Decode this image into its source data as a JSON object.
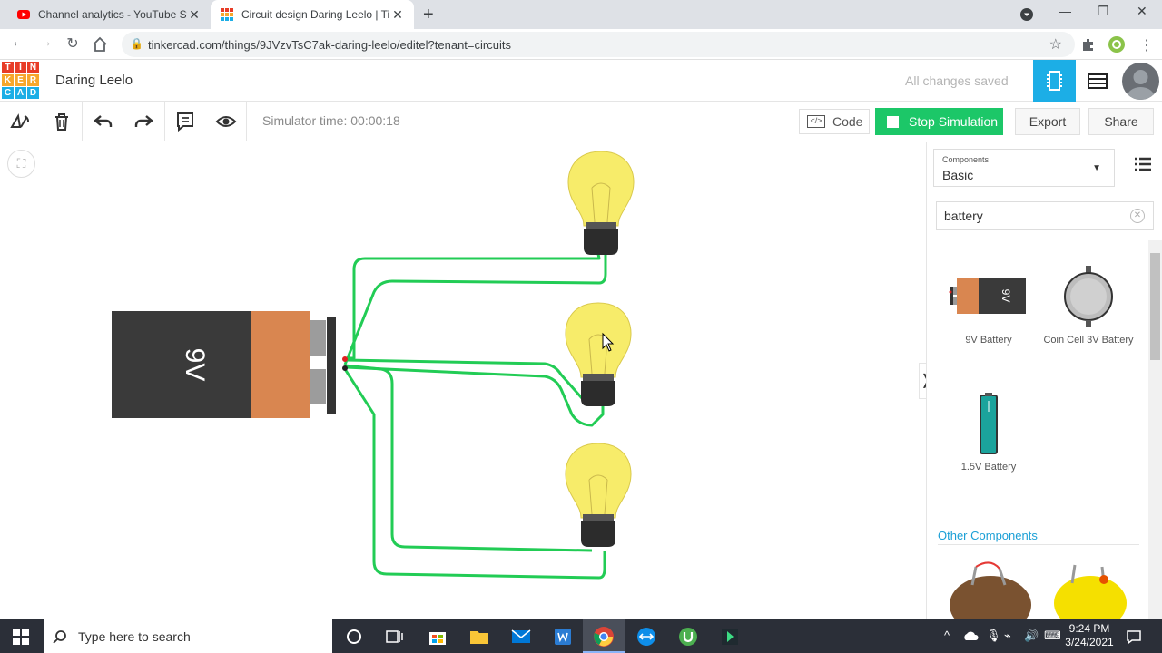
{
  "browser": {
    "tabs": [
      {
        "label": "Channel analytics - YouTube Stud",
        "active": false,
        "icon": "youtube-icon"
      },
      {
        "label": "Circuit design Daring Leelo | Tink",
        "active": true,
        "icon": "tinkercad-icon"
      }
    ],
    "url": "tinkercad.com/things/9JVzvTsC7ak-daring-leelo/editel?tenant=circuits"
  },
  "app": {
    "logo_letters": [
      "T",
      "I",
      "N",
      "K",
      "E",
      "R",
      "C",
      "A",
      "D"
    ],
    "logo_colors": [
      "#e83c27",
      "#e83c27",
      "#e83c27",
      "#f7a72c",
      "#f7a72c",
      "#f7a72c",
      "#1caee6",
      "#1caee6",
      "#1caee6"
    ],
    "project_title": "Daring Leelo",
    "save_status": "All changes saved"
  },
  "toolbar": {
    "simulator_time": "Simulator time: 00:00:18",
    "code_label": "Code",
    "stop_label": "Stop Simulation",
    "export_label": "Export",
    "share_label": "Share"
  },
  "canvas": {
    "battery_label": "9V",
    "wire_color": "#22cc55",
    "bulb_color": "#f7ec6a",
    "bulb_count": 3
  },
  "panel": {
    "components_small_label": "Components",
    "components_value": "Basic",
    "search_value": "battery",
    "results": [
      {
        "label": "9V Battery"
      },
      {
        "label": "Coin Cell 3V Battery"
      },
      {
        "label": "1.5V Battery"
      }
    ],
    "other_components": "Other Components"
  },
  "taskbar": {
    "search_placeholder": "Type here to search",
    "time": "9:24 PM",
    "date": "3/24/2021"
  }
}
